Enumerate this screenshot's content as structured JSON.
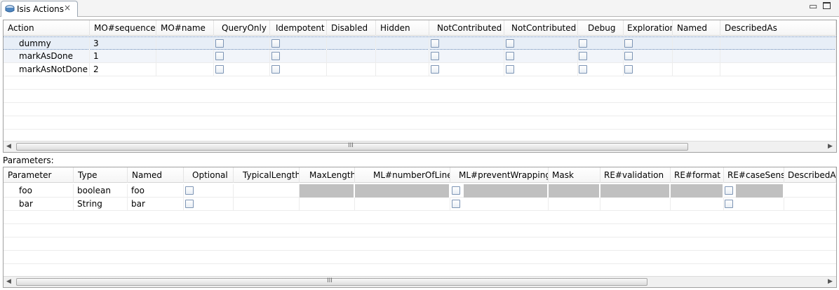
{
  "view": {
    "title": "Isis Actions",
    "close_glyph": "×"
  },
  "window_controls": {
    "minimize_glyph": "▭"
  },
  "actions": {
    "columns": [
      "Action",
      "MO#sequence",
      "MO#name",
      "QueryOnly",
      "Idempotent",
      "Disabled",
      "Hidden",
      "NotContributed",
      "NotContributed",
      "Debug",
      "Exploration",
      "Named",
      "DescribedAs"
    ],
    "rows": [
      {
        "action": "dummy",
        "sequence": "3"
      },
      {
        "action": "markAsDone",
        "sequence": "1"
      },
      {
        "action": "markAsNotDone",
        "sequence": "2"
      }
    ],
    "scroll_grip": "III"
  },
  "parameters_label": "Parameters:",
  "parameters": {
    "columns": [
      "Parameter",
      "Type",
      "Named",
      "Optional",
      "TypicalLength",
      "MaxLength",
      "ML#numberOfLines",
      "ML#preventWrapping",
      "Mask",
      "RE#validation",
      "RE#format",
      "RE#caseSens...",
      "DescribedAs"
    ],
    "rows": [
      {
        "parameter": "foo",
        "type": "boolean",
        "named": "foo"
      },
      {
        "parameter": "bar",
        "type": "String",
        "named": "bar"
      }
    ],
    "scroll_grip": "III"
  },
  "scroll_arrows": {
    "left": "◀",
    "right": "▶"
  },
  "icons": {
    "view": "eclipse-view-icon",
    "close": "close-icon",
    "minimize": "minimize-icon",
    "maximize": "maximize-icon"
  }
}
